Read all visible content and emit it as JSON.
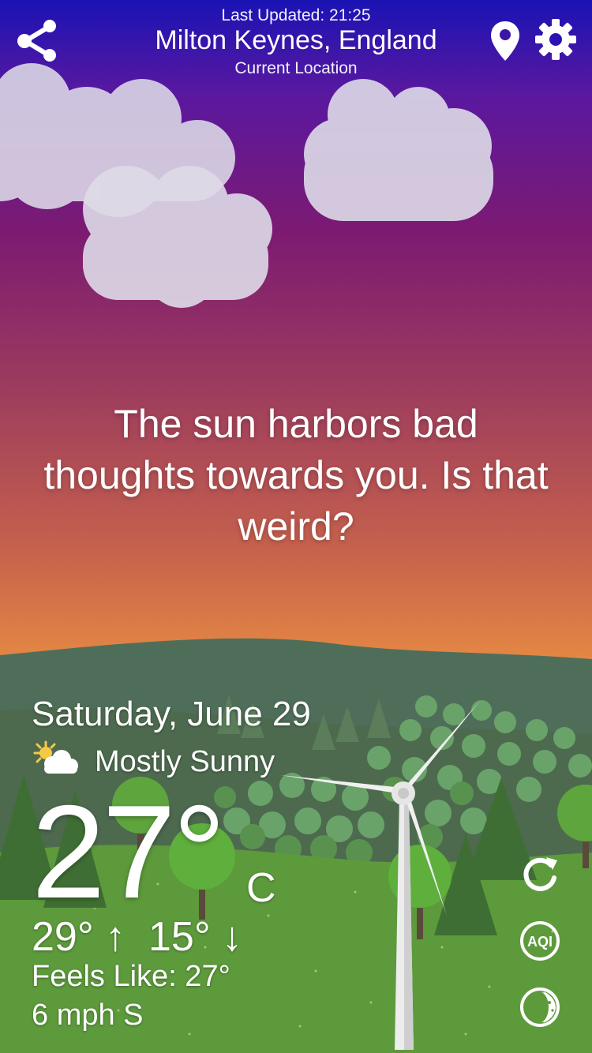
{
  "header": {
    "last_updated": "Last Updated: 21:25",
    "city": "Milton Keynes, England",
    "location_label": "Current Location"
  },
  "message": "The sun harbors bad thoughts towards you. Is that weird?",
  "forecast": {
    "date": "Saturday, June 29",
    "condition": "Mostly Sunny",
    "condition_icon": "partly-sunny-icon",
    "temperature": "27°",
    "unit": "C",
    "high_low": "29° ↑  15° ↓",
    "feels_like": "Feels Like: 27°",
    "wind": "6 mph S"
  },
  "icons": {
    "share": "share-icon",
    "location": "location-pin-icon",
    "settings": "gear-icon",
    "refresh": "refresh-icon",
    "aqi": "AQI",
    "moon": "moon-icon"
  },
  "colors": {
    "sky_top": "#1a13b4",
    "sky_mid": "#9b3a5e",
    "sky_horizon": "#f09b45",
    "grass": "#5d9a3c",
    "hills": "#4f6e5a"
  }
}
